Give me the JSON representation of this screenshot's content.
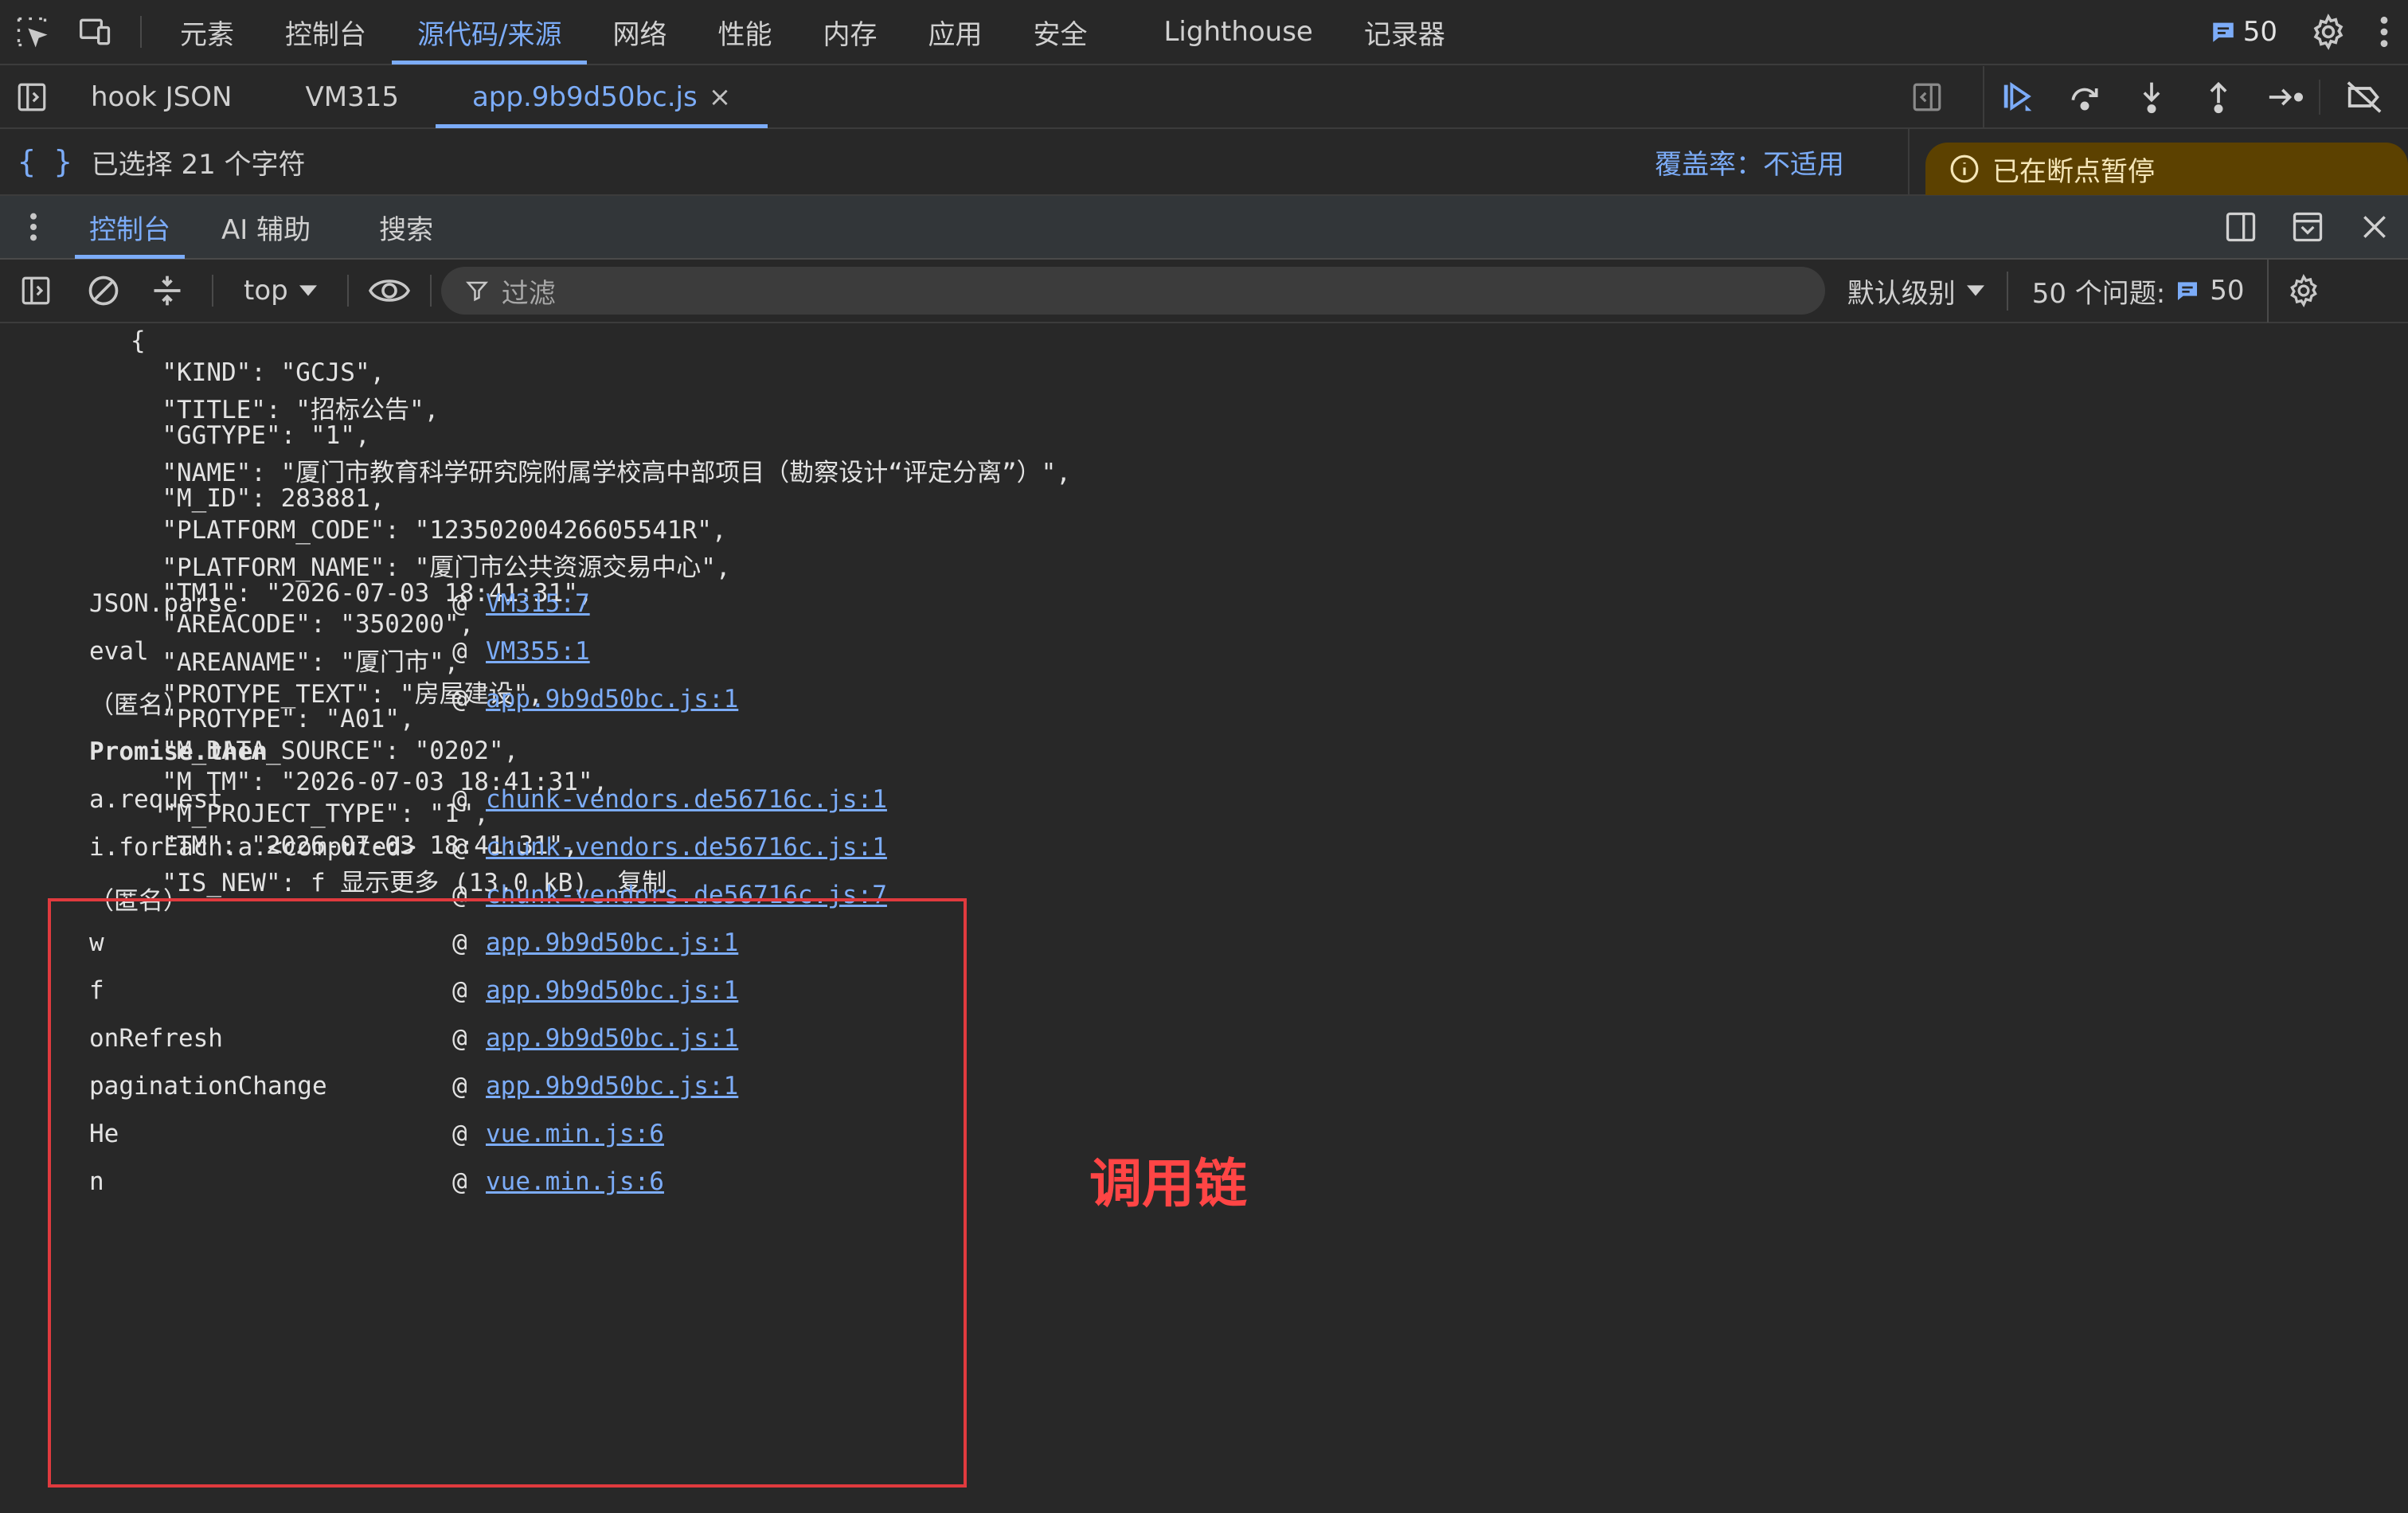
{
  "top_tabs": [
    "元素",
    "控制台",
    "源代码/来源",
    "网络",
    "性能",
    "内存",
    "应用",
    "安全",
    "Lighthouse",
    "记录器"
  ],
  "top_active_tab": "源代码/来源",
  "issues_count": "50",
  "file_tabs": [
    "hook JSON",
    "VM315",
    "app.9b9d50bc.js"
  ],
  "file_close": "×",
  "selection_status": "已选择 21 个字符",
  "coverage_label": "覆盖率：",
  "coverage_value": "不适用",
  "paused_banner": "已在断点暂停",
  "drawer_tabs": [
    "控制台",
    "AI 辅助",
    "搜索"
  ],
  "console_toolbar": {
    "context": "top",
    "filter_placeholder": "过滤",
    "level": "默认级别",
    "issues_label": "50 个问题:",
    "issues_count": "50"
  },
  "json_lines": [
    "{",
    "  \"KIND\": \"GCJS\",",
    "  \"TITLE\": \"招标公告\",",
    "  \"GGTYPE\": \"1\",",
    "  \"NAME\": \"厦门市教育科学研究院附属学校高中部项目（勘察设计“评定分离”）\",",
    "  \"M_ID\": 283881,",
    "  \"PLATFORM_CODE\": \"12350200426605541R\",",
    "  \"PLATFORM_NAME\": \"厦门市公共资源交易中心\",",
    "  \"TM1\": \"2026-07-03 18:41:31\",",
    "  \"AREACODE\": \"350200\",",
    "  \"AREANAME\": \"厦门市\",",
    "  \"PROTYPE_TEXT\": \"房屋建设\",",
    "  \"PROTYPE\": \"A01\",",
    "  \"M_DATA_SOURCE\": \"0202\",",
    "  \"M_TM\": \"2026-07-03 18:41:31\",",
    "  \"M_PROJECT_TYPE\": \"1\",",
    "  \"TM\": \"2026-07-03 18:41:31\",",
    "  \"IS_NEW\": f 显示更多 (13.0 kB)  复制"
  ],
  "stack_trace": [
    {
      "fn": "JSON.parse",
      "at": "@",
      "link": "VM315:7",
      "bold": false
    },
    {
      "fn": "eval",
      "at": "@",
      "link": "VM355:1",
      "bold": false
    },
    {
      "fn": "（匿名）",
      "at": "@",
      "link": "app.9b9d50bc.js:1",
      "bold": false
    },
    {
      "fn": "Promise.then",
      "at": "",
      "link": "",
      "bold": true
    },
    {
      "fn": "a.request",
      "at": "@",
      "link": "chunk-vendors.de56716c.js:1",
      "bold": false
    },
    {
      "fn": "i.forEach.a.<computed>",
      "at": "@",
      "link": "chunk-vendors.de56716c.js:1",
      "bold": false
    },
    {
      "fn": "（匿名）",
      "at": "@",
      "link": "chunk-vendors.de56716c.js:7",
      "bold": false
    },
    {
      "fn": "w",
      "at": "@",
      "link": "app.9b9d50bc.js:1",
      "bold": false
    },
    {
      "fn": "f",
      "at": "@",
      "link": "app.9b9d50bc.js:1",
      "bold": false
    },
    {
      "fn": "onRefresh",
      "at": "@",
      "link": "app.9b9d50bc.js:1",
      "bold": false
    },
    {
      "fn": "paginationChange",
      "at": "@",
      "link": "app.9b9d50bc.js:1",
      "bold": false
    },
    {
      "fn": "He",
      "at": "@",
      "link": "vue.min.js:6",
      "bold": false
    },
    {
      "fn": "n",
      "at": "@",
      "link": "vue.min.js:6",
      "bold": false
    }
  ],
  "annotation_label": "调用链",
  "colors": {
    "accent": "#7cacf8",
    "annotation": "#e03a3e",
    "paused_bg": "#5c4100"
  }
}
